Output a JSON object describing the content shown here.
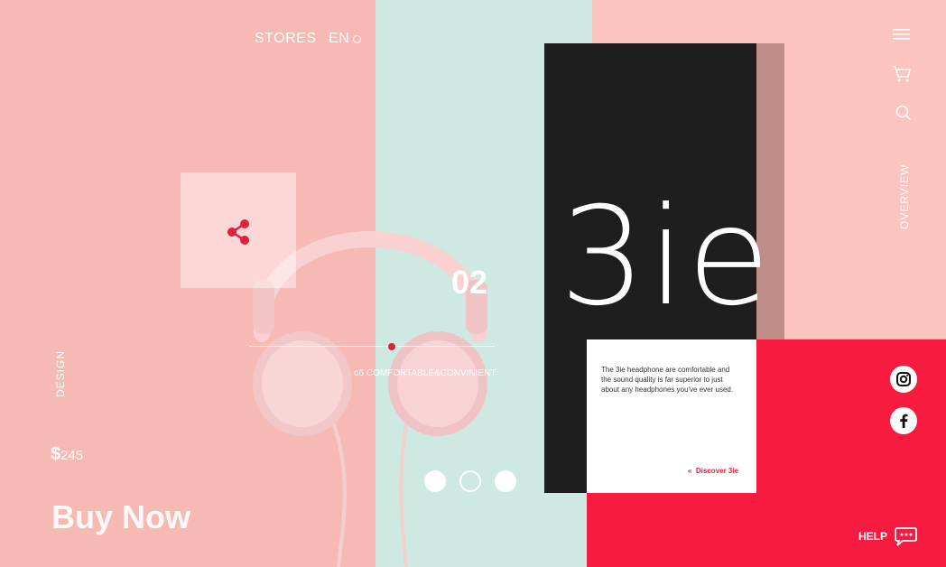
{
  "header": {
    "stores_label": "STORES",
    "language_label": "EN"
  },
  "sidebar": {
    "overview_label": "OVERVIEW"
  },
  "left": {
    "design_label": "DESIGN",
    "price_currency": "$",
    "price_value": "245",
    "buy_label": "Buy Now"
  },
  "hero": {
    "slide_number": "02",
    "slide_caption": "o6 COMFORTABLE&CONVINIENT",
    "slider_progress": 0.58
  },
  "brand": {
    "name": "3ie",
    "description": "The 3ie headphone are comfortable and the sound quality is far superior to just about any headphones you've ever used.",
    "discover_label": "Discover 3ie"
  },
  "pager": {
    "count": 3,
    "active_index": 1
  },
  "footer": {
    "help_label": "HELP"
  },
  "icons": [
    "menu-icon",
    "cart-icon",
    "search-icon",
    "share-icon",
    "instagram-icon",
    "facebook-icon",
    "chat-icon"
  ],
  "colors": {
    "pink": "#f7b9b4",
    "mint": "#cde9e2",
    "black": "#1e1e1e",
    "red": "#f71b3f"
  }
}
